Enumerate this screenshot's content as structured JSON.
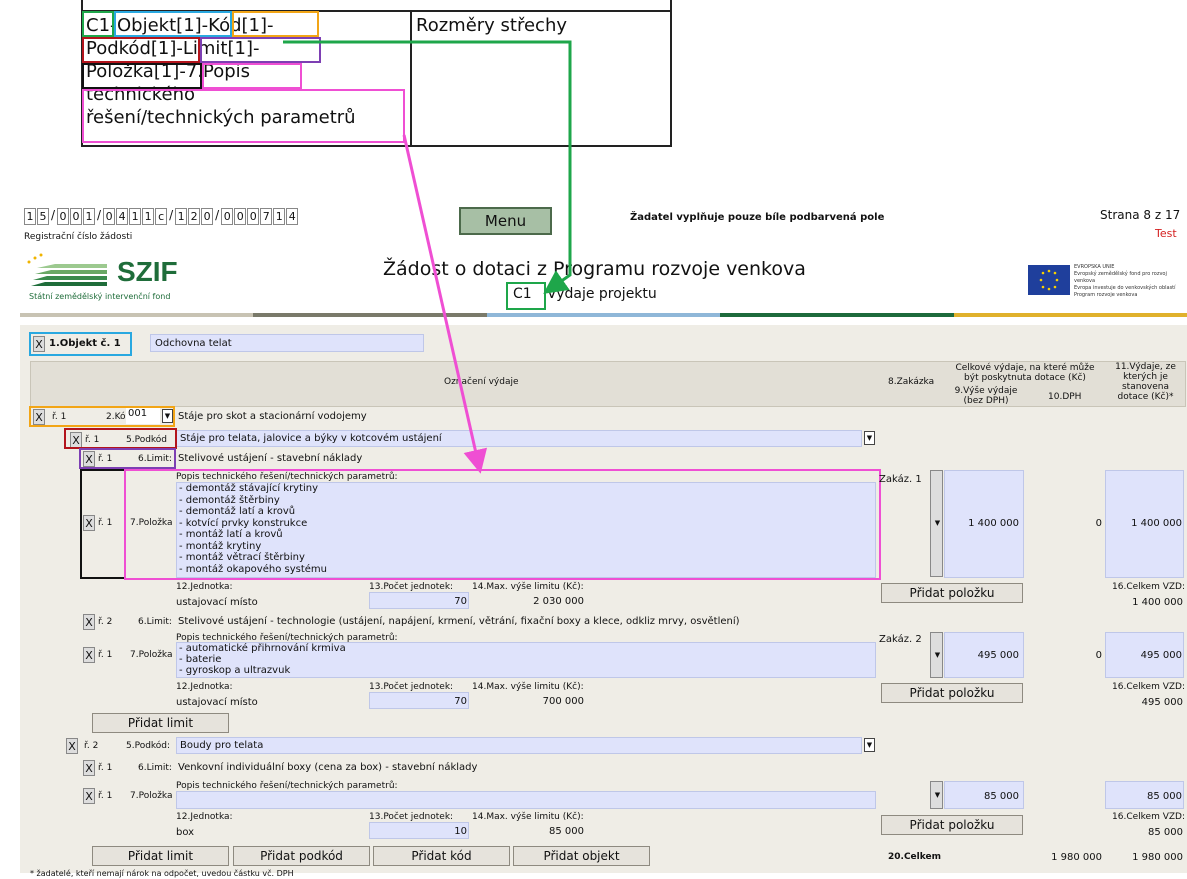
{
  "snippet": {
    "left_lines": [
      "C1-Objekt[1]-Kód[1]-",
      "Podkód[1]-Limit[1]-",
      "Položka[1]-7.Popis",
      "technického",
      "řešení/technických parametrů"
    ],
    "right_text": "Rozměry střechy"
  },
  "header": {
    "reg_digits": [
      "1",
      "5",
      "/",
      "0",
      "0",
      "1",
      "/",
      "0",
      "4",
      "1",
      "1",
      "c",
      "/",
      "1",
      "2",
      "0",
      "/",
      "0",
      "0",
      "0",
      "7",
      "1",
      "4"
    ],
    "reg_label": "Registrační číslo žádosti",
    "menu_label": "Menu",
    "notice": "Žadatel vyplňuje pouze bíle podbarvená pole",
    "page": "Strana 8 z 17",
    "mode": "Test",
    "logo_text": "SZIF",
    "logo_sub": "Státní zemědělský intervenční fond",
    "title": "Žádost o dotaci z Programu rozvoje venkova",
    "section_code": "C1",
    "section_title": "Výdaje projektu",
    "eu_lines": [
      "EVROPSKÁ UNIE",
      "Evropský zemědělský fond pro rozvoj venkova",
      "Evropa investuje do venkovských oblastí",
      "Program rozvoje venkova"
    ]
  },
  "objekt": {
    "label": "1.Objekt č. 1",
    "value": "Odchovna telat"
  },
  "columns": {
    "oznaceni": "Označení výdaje",
    "zakazka": "8.Zakázka",
    "celkove": "Celkové výdaje, na které může být poskytnuta dotace (Kč)",
    "vyse": "9.Výše výdaje (bez DPH)",
    "dph": "10.DPH",
    "vydaje11": "11.Výdaje, ze kterých je stanovena dotace (Kč)*"
  },
  "rows": {
    "kod_r": "ř. 1",
    "kod_label": "2.Kód:",
    "kod_value": "001",
    "kod_text": "Stáje pro skot a stacionární vodojemy",
    "podkod_r": "ř. 1",
    "podkod_label": "5.Podkód",
    "podkod_text": "Stáje pro telata, jalovice a býky v kotcovém ustájení",
    "limit1_r": "ř. 1",
    "limit1_label": "6.Limit:",
    "limit1_text": "Stelivové ustájení - stavební náklady",
    "pol1_r": "ř. 1",
    "pol1_label": "7.Položka",
    "popis_label": "Popis technického řešení/technických parametrů:",
    "pol1_items": [
      "- demontáž stávající krytiny",
      "- demontáž štěrbiny",
      "- demontáž latí a krovů",
      "- kotvící prvky konstrukce",
      "- montáž latí a krovů",
      "- montáž krytiny",
      "- montáž větrací štěrbiny",
      "- montáž okapového systému"
    ],
    "pol1_zakazka": "Zakáz. 1",
    "pol1_vyse": "1 400 000",
    "pol1_dph": "0",
    "pol1_v11": "1 400 000",
    "jednotka_label": "12.Jednotka:",
    "pocet_label": "13.Počet jednotek:",
    "max_label": "14.Max. výše limitu (Kč):",
    "pol1_jednotka": "ustajovací místo",
    "pol1_pocet": "70",
    "pol1_max": "2 030 000",
    "pridat_polozku": "Přidat položku",
    "celkem_vzd_label": "16.Celkem VZD:",
    "pol1_celkem": "1 400 000",
    "limit2_r": "ř. 2",
    "limit2_label": "6.Limit:",
    "limit2_text": "Stelivové ustájení - technologie (ustájení, napájení, krmení, větrání, fixační boxy a klece, odkliz mrvy, osvětlení)",
    "pol2_r": "ř. 1",
    "pol2_label": "7.Položka",
    "pol2_items": [
      "- automatické přihrnování krmiva",
      "- baterie",
      "- gyroskop a ultrazvuk"
    ],
    "pol2_zakazka": "Zakáz. 2",
    "pol2_vyse": "495 000",
    "pol2_dph": "0",
    "pol2_v11": "495 000",
    "pol2_jednotka": "ustajovací místo",
    "pol2_pocet": "70",
    "pol2_max": "700 000",
    "pol2_celkem": "495 000",
    "pridat_limit": "Přidat limit",
    "podkod2_r": "ř. 2",
    "podkod2_label": "5.Podkód:",
    "podkod2_text": "Boudy pro telata",
    "limit3_r": "ř. 1",
    "limit3_label": "6.Limit:",
    "limit3_text": "Venkovní individuální boxy (cena za box) - stavební náklady",
    "pol3_r": "ř. 1",
    "pol3_label": "7.Položka",
    "pol3_vyse": "85 000",
    "pol3_v11": "85 000",
    "pol3_jednotka": "box",
    "pol3_pocet": "10",
    "pol3_max": "85 000",
    "pol3_celkem": "85 000",
    "pridat_podkod": "Přidat podkód",
    "pridat_kod": "Přidat kód",
    "pridat_objekt": "Přidat objekt",
    "celkem20_label": "20.Celkem",
    "celkem20_vyse": "1 980 000",
    "celkem20_v11": "1 980 000",
    "footnote": "* žadatelé, kteří nemají nárok na odpočet, uvedou částku vč. DPH",
    "x": "X"
  },
  "colors": {
    "green": "#1ea64a",
    "magenta": "#ef4fd3",
    "cyan": "#29a8e0",
    "orange": "#f2a516",
    "red": "#b3141c",
    "purple": "#7d3fb3",
    "black": "#111"
  }
}
